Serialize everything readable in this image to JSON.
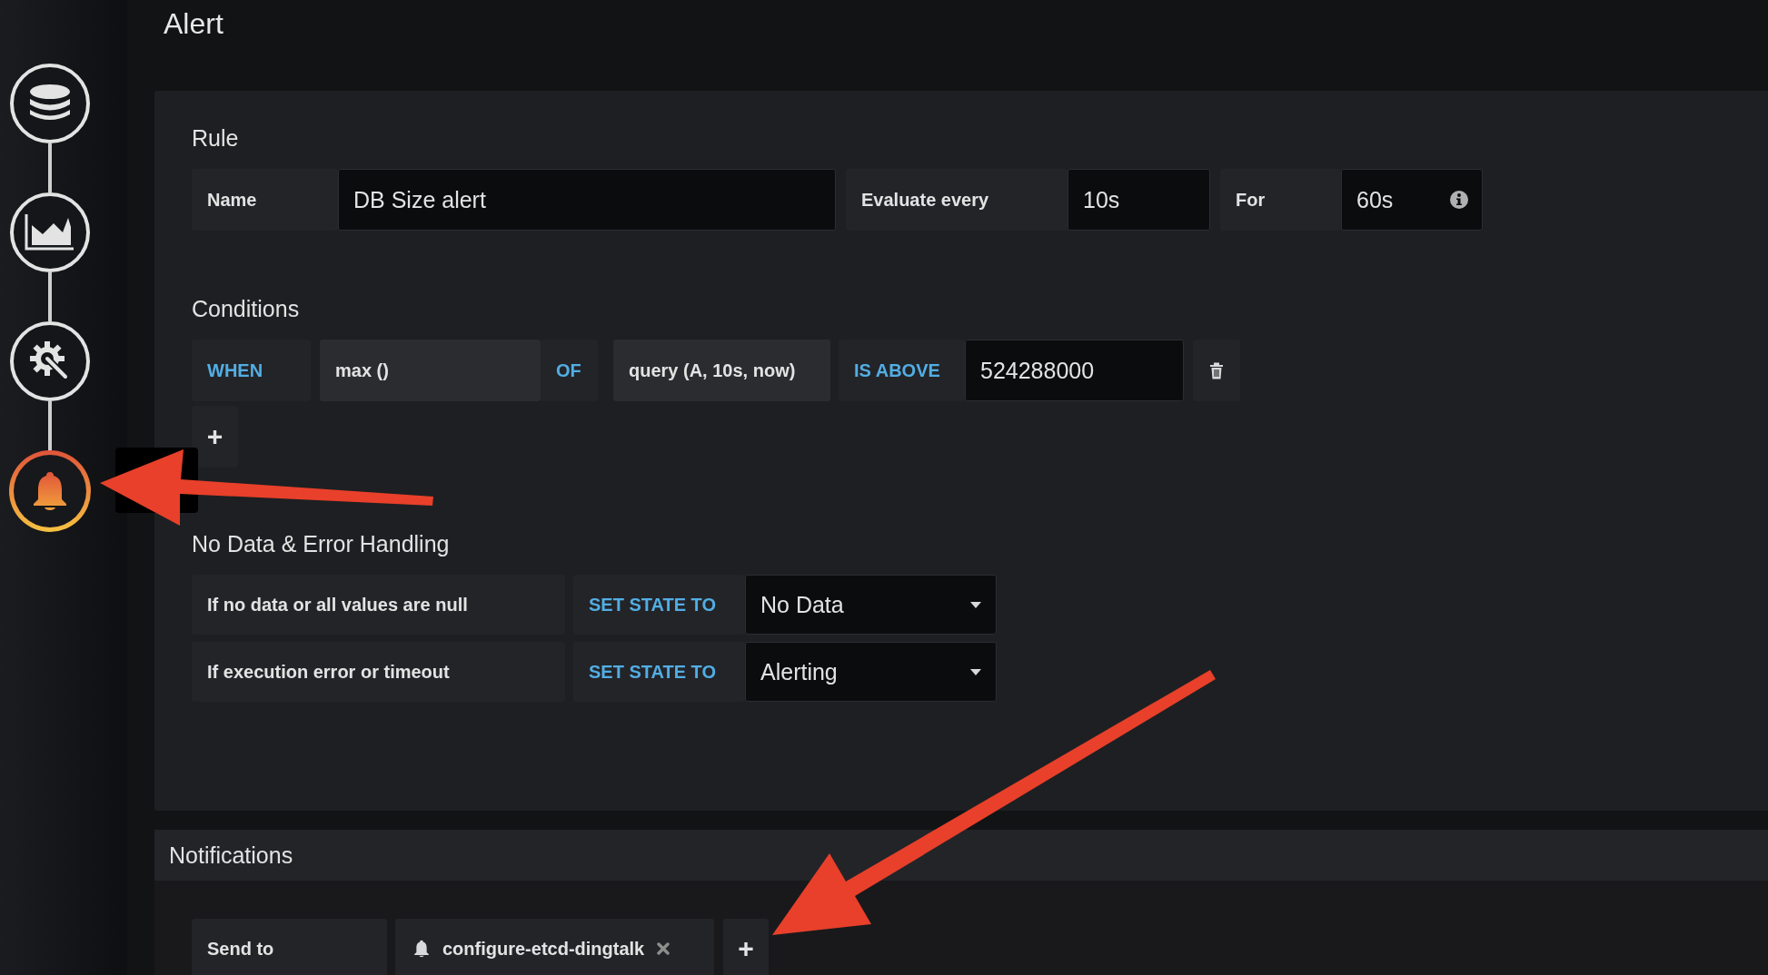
{
  "page": {
    "title": "Alert"
  },
  "sidebar": {
    "steps": [
      {
        "kind": "database",
        "selected": false
      },
      {
        "kind": "chart",
        "selected": false
      },
      {
        "kind": "settings",
        "selected": false
      },
      {
        "kind": "alert",
        "selected": true
      }
    ]
  },
  "rule": {
    "heading": "Rule",
    "fields": [
      {
        "label": "Name",
        "value": "DB Size alert",
        "info": false
      },
      {
        "label": "Evaluate every",
        "value": "10s",
        "info": false
      },
      {
        "label": "For",
        "value": "60s",
        "info": true
      }
    ]
  },
  "conditions": {
    "heading": "Conditions",
    "rows": [
      {
        "when": "WHEN",
        "reducer": "max ()",
        "of": "OF",
        "query": "query (A, 10s, now)",
        "evaluator": "IS ABOVE",
        "threshold": "524288000"
      }
    ],
    "add_button": "+"
  },
  "no_data": {
    "heading": "No Data & Error Handling",
    "rows": [
      {
        "label": "If no data or all values are null",
        "keyword": "SET STATE TO",
        "value": "No Data"
      },
      {
        "label": "If execution error or timeout",
        "keyword": "SET STATE TO",
        "value": "Alerting"
      }
    ]
  },
  "notifications": {
    "heading": "Notifications",
    "send_to_label": "Send to",
    "tags": [
      {
        "name": "configure-etcd-dingtalk"
      }
    ],
    "add_button": "+"
  }
}
